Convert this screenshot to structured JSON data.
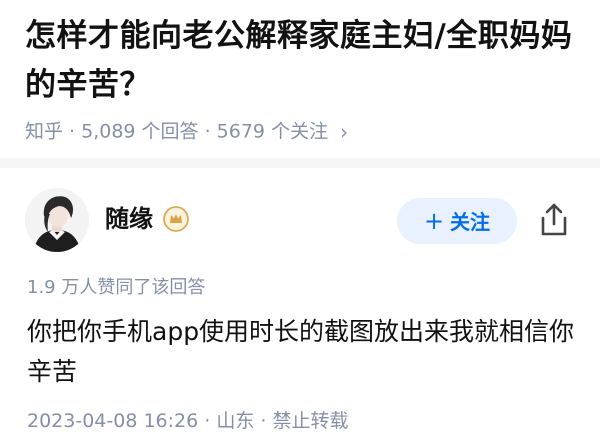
{
  "question": {
    "title": "怎样才能向老公解释家庭主妇/全职妈妈的辛苦？",
    "meta": "知乎 · 5,089 个回答 · 5679 个关注",
    "meta_chevron": "›"
  },
  "answer": {
    "author_name": "随缘",
    "follow_plus": "+",
    "follow_label": "关注",
    "likes_text": "1.9 万人赞同了该回答",
    "content": "你把你手机app使用时长的截图放出来我就相信你辛苦",
    "footer": "2023-04-08 16:26 · 山东 · 禁止转载"
  },
  "colors": {
    "accent": "#056de8",
    "follow_bg": "#e8f1fd",
    "meta_gray": "#8590a6",
    "badge_gold": "#d9a441"
  },
  "icons": {
    "avatar": "avatar-illustration",
    "badge": "crown-badge-icon",
    "share": "share-icon",
    "chevron": "chevron-right-icon"
  }
}
